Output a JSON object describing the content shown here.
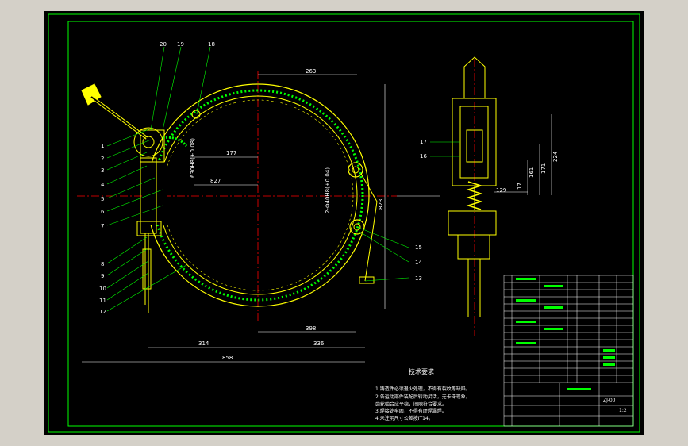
{
  "colors": {
    "background": "#d4d0c8",
    "sheet": "#000000",
    "border": "#00ff00",
    "part": "#ffff00",
    "teeth": "#00ff00",
    "dimension": "#ffffff",
    "centerline": "#ff0000",
    "leader": "#00ff00"
  },
  "balloons_left": [
    "1",
    "2",
    "3",
    "4",
    "5",
    "6",
    "7",
    "8",
    "9",
    "10",
    "11",
    "12"
  ],
  "balloons_top": [
    "20",
    "19",
    "18"
  ],
  "balloons_right": [
    "15",
    "14",
    "13"
  ],
  "balloons_side": [
    "17",
    "16"
  ],
  "dimensions": {
    "d263": "263",
    "d177": "177",
    "d827": "827",
    "d823": "823",
    "d398": "398",
    "d314": "314",
    "d336": "336",
    "d858": "858",
    "d129": "129",
    "d224": "224",
    "d171": "171",
    "d161": "161",
    "d17": "17",
    "rot_a": "630H8(+0.08)",
    "rot_b": "2-Φ40H8(+0.04)"
  },
  "tech_req": {
    "title": "技术要求",
    "lines": [
      "1.铸造件必须退火处理，不得有裂纹等缺陷。",
      "2.各运动部件装配后转动灵活，无卡滞现象。",
      "  齿轮啮合应平稳，间隙符合要求。",
      "3.焊接处牢固，不得有虚焊漏焊。",
      "4.未注明尺寸公差按IT14。"
    ]
  },
  "title_block": {
    "scale_label": "1:2",
    "drawing_no": "ZJ-00",
    "row_labels": [
      "13",
      "12",
      "11",
      "10",
      "9",
      "8",
      "7",
      "6",
      "5",
      "4",
      "3",
      "2",
      "1"
    ]
  }
}
